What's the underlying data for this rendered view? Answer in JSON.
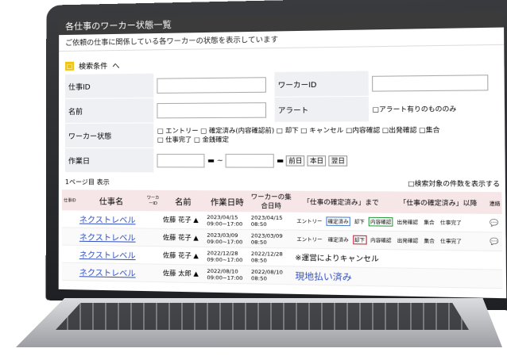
{
  "window": {
    "title": "各仕事のワーカー状態一覧"
  },
  "description": "ご依頼の仕事に関係している各ワーカーの状態を表示しています",
  "search": {
    "heading": "検索条件",
    "toggle": "へ",
    "job_id_label": "仕事ID",
    "worker_id_label": "ワーカーID",
    "name_label": "名前",
    "alert_label": "アラート",
    "alert_option": "アラート有りのもののみ",
    "status_label": "ワーカー状態",
    "status_options": [
      "エントリー",
      "確定済み(内容確認前)",
      "却下",
      "キャンセル",
      "内容確認",
      "出発確認",
      "集合",
      "仕事完了",
      "金銭確定"
    ],
    "date_label": "作業日",
    "range_sep": "~",
    "buttons": [
      "前日",
      "本日",
      "翌日"
    ]
  },
  "pager": {
    "page_text": "1ページ目 表示",
    "count_option": "検索対象の件数を表示する"
  },
  "table": {
    "headers": [
      "仕事ID",
      "仕事名",
      "ワーカーID",
      "名前",
      "作業日時",
      "ワーカーの集合日時",
      "「仕事の確定済み」まで",
      "「仕事の確定済み」以降",
      "連絡"
    ],
    "rows": [
      {
        "job": "ネクストレベル",
        "name": "佐藤 花子",
        "date": "2023/04/15",
        "time": "09:00~17:00",
        "meet_date": "2023/04/15",
        "meet_time": "08:50",
        "mode": "tags",
        "tags": [
          "エントリー",
          "確定済み",
          "却下",
          "内容確認",
          "出発確認",
          "集合",
          "仕事完了"
        ],
        "status_note": ""
      },
      {
        "job": "ネクストレベル",
        "name": "佐藤 花子",
        "date": "2023/03/09",
        "time": "09:00~17:00",
        "meet_date": "2023/03/09",
        "meet_time": "08:50",
        "mode": "tags",
        "tags": [
          "エントリー",
          "確定済み",
          "却下",
          "内容確認",
          "出発確認",
          "集合",
          "仕事完了"
        ],
        "status_note": ""
      },
      {
        "job": "ネクストレベル",
        "name": "佐藤 花子",
        "date": "2022/12/28",
        "time": "09:00~17:00",
        "meet_date": "2022/12/28",
        "meet_time": "08:50",
        "mode": "note",
        "status_note": "※運営によりキャンセル"
      },
      {
        "job": "ネクストレベル",
        "name": "佐藤 太郎",
        "date": "2022/08/10",
        "time": "09:00~17:00",
        "meet_date": "2022/08/10",
        "meet_time": "08:50",
        "mode": "paid",
        "status_note": "現地払い済み"
      }
    ]
  },
  "colors": {
    "title_bar": "#3b3b3b",
    "accent": "#f1c40f",
    "link": "#2f4fc0",
    "header_bg": "#f6e6e8"
  }
}
